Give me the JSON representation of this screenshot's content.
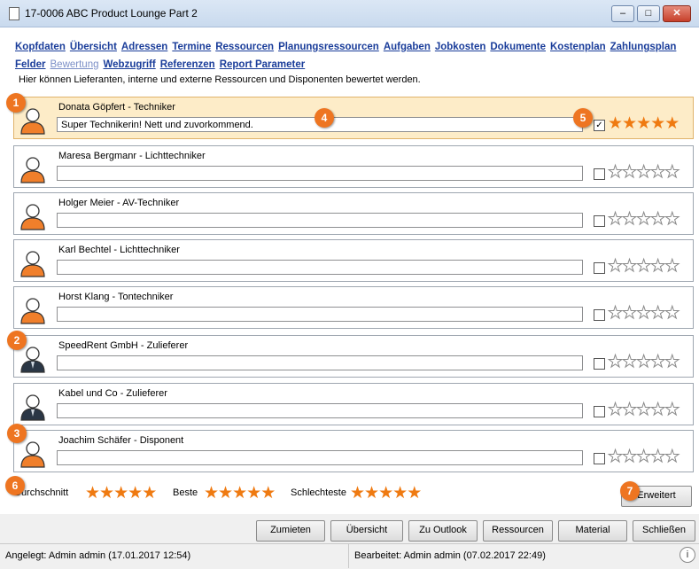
{
  "window": {
    "title": "17-0006 ABC Product Lounge Part 2",
    "minimize": "–",
    "maximize": "□",
    "close": "✕"
  },
  "nav": [
    {
      "label": "Kopfdaten"
    },
    {
      "label": "Übersicht"
    },
    {
      "label": "Adressen"
    },
    {
      "label": "Termine"
    },
    {
      "label": "Ressourcen"
    },
    {
      "label": "Planungsressourcen"
    },
    {
      "label": "Aufgaben"
    },
    {
      "label": "Jobkosten"
    },
    {
      "label": "Dokumente"
    },
    {
      "label": "Kostenplan"
    },
    {
      "label": "Zahlungsplan"
    },
    {
      "label": "Felder"
    },
    {
      "label": "Bewertung"
    },
    {
      "label": "Webzugriff"
    },
    {
      "label": "Referenzen"
    },
    {
      "label": "Report Parameter"
    }
  ],
  "hint": "Hier können Lieferanten, interne und externe Ressourcen und Disponenten bewertet werden.",
  "ratings": [
    {
      "name": "Donata Göpfert - Techniker",
      "comment": "Super Technikerin! Nett und zuvorkommend.",
      "checked": true,
      "stars": 5,
      "type": "person"
    },
    {
      "name": "Maresa Bergmanr  - Lichttechniker",
      "comment": "",
      "checked": false,
      "stars": 0,
      "type": "person"
    },
    {
      "name": "Holger Meier - AV-Techniker",
      "comment": "",
      "checked": false,
      "stars": 0,
      "type": "person"
    },
    {
      "name": "Karl Bechtel - Lichttechniker",
      "comment": "",
      "checked": false,
      "stars": 0,
      "type": "person"
    },
    {
      "name": "Horst Klang - Tontechniker",
      "comment": "",
      "checked": false,
      "stars": 0,
      "type": "person"
    },
    {
      "name": "SpeedRent GmbH - Zulieferer",
      "comment": "",
      "checked": false,
      "stars": 0,
      "type": "supplier"
    },
    {
      "name": "Kabel und Co - Zulieferer",
      "comment": "",
      "checked": false,
      "stars": 0,
      "type": "supplier"
    },
    {
      "name": "Joachim Schäfer - Disponent",
      "comment": "",
      "checked": false,
      "stars": 0,
      "type": "person"
    }
  ],
  "summary": {
    "average_label": "Durchschnitt",
    "average_stars": 5,
    "best_label": "Beste",
    "best_stars": 5,
    "worst_label": "Schlechteste",
    "worst_stars": 5
  },
  "buttons": {
    "advanced": "Erweitert",
    "zumieten": "Zumieten",
    "uebersicht": "Übersicht",
    "outlook": "Zu Outlook",
    "ressourcen": "Ressourcen",
    "material": "Material",
    "schliessen": "Schließen"
  },
  "status": {
    "created": "Angelegt: Admin admin (17.01.2017 12:54)",
    "edited": "Bearbeitet:  Admin admin (07.02.2017 22:49)",
    "info": "i"
  },
  "callouts": [
    "1",
    "2",
    "3",
    "4",
    "5",
    "6",
    "7"
  ],
  "colors": {
    "accent": "#ee7521",
    "star": "#ef7a11",
    "selected_row": "#fdecc8",
    "link": "#1a3d9a"
  }
}
